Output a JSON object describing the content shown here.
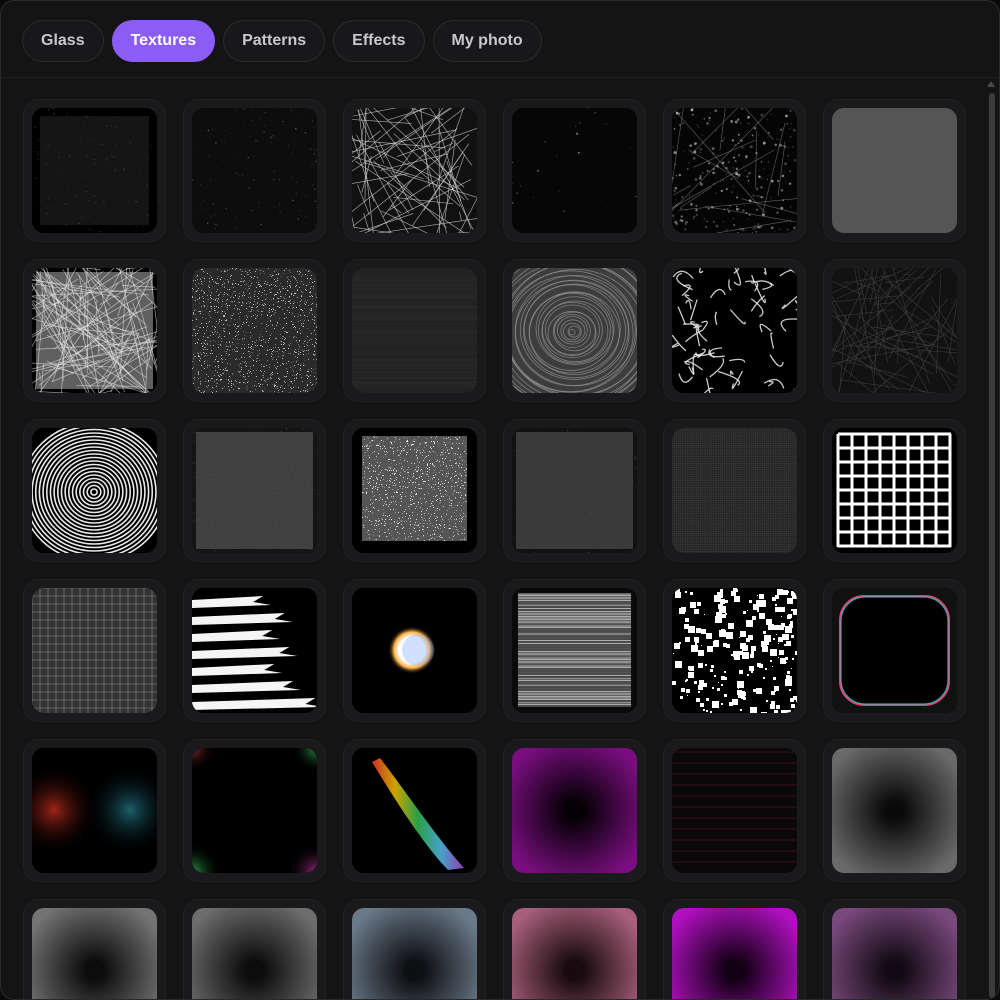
{
  "tabs": [
    {
      "label": "Glass",
      "active": false
    },
    {
      "label": "Textures",
      "active": true
    },
    {
      "label": "Patterns",
      "active": false
    },
    {
      "label": "Effects",
      "active": false
    },
    {
      "label": "My photo",
      "active": false
    }
  ],
  "accent_color": "#8b5cf6",
  "textures": [
    {
      "name": "dark-noise-framed"
    },
    {
      "name": "sparse-dust"
    },
    {
      "name": "scratches"
    },
    {
      "name": "star-specks"
    },
    {
      "name": "grunge-cracks"
    },
    {
      "name": "fine-gray-weave"
    },
    {
      "name": "crumpled-paper"
    },
    {
      "name": "salt-pepper-noise"
    },
    {
      "name": "dark-streaks"
    },
    {
      "name": "tree-rings"
    },
    {
      "name": "caustic-web"
    },
    {
      "name": "dark-crackle"
    },
    {
      "name": "fingerprint"
    },
    {
      "name": "gray-felt"
    },
    {
      "name": "static-noise"
    },
    {
      "name": "dark-gray-felt"
    },
    {
      "name": "fine-mesh"
    },
    {
      "name": "white-grid"
    },
    {
      "name": "square-grid"
    },
    {
      "name": "brush-strokes"
    },
    {
      "name": "light-orb"
    },
    {
      "name": "scanlines"
    },
    {
      "name": "splatter-blocks"
    },
    {
      "name": "chromatic-vignette"
    },
    {
      "name": "red-cyan-blur"
    },
    {
      "name": "corner-glow"
    },
    {
      "name": "rainbow-flare"
    },
    {
      "name": "purple-vignette"
    },
    {
      "name": "red-lines"
    },
    {
      "name": "gray-vignette"
    },
    {
      "name": "gray-vignette-2"
    },
    {
      "name": "gray-vignette-3"
    },
    {
      "name": "blue-gray-vignette"
    },
    {
      "name": "pink-vignette"
    },
    {
      "name": "magenta-vignette"
    },
    {
      "name": "mauve-vignette"
    }
  ]
}
